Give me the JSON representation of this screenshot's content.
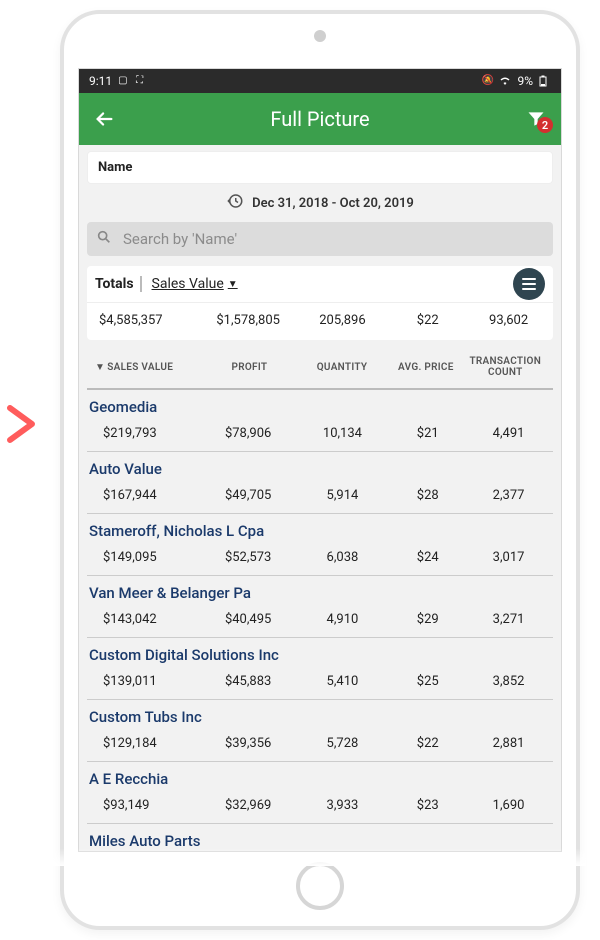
{
  "statusbar": {
    "time": "9:11",
    "battery": "9%"
  },
  "header": {
    "title": "Full Picture",
    "filter_badge": "2"
  },
  "filter_pill": {
    "label": "Name"
  },
  "date_range": {
    "text": "Dec 31, 2018 - Oct 20, 2019"
  },
  "search": {
    "placeholder": "Search by 'Name'"
  },
  "totals": {
    "label": "Totals",
    "sort_by": "Sales Value",
    "values": {
      "sales_value": "$4,585,357",
      "profit": "$1,578,805",
      "quantity": "205,896",
      "avg_price": "$22",
      "transaction_count": "93,602"
    }
  },
  "columns": {
    "sales_value": "SALES VALUE",
    "profit": "PROFIT",
    "quantity": "QUANTITY",
    "avg_price": "AVG. PRICE",
    "transaction_count": "TRANSACTION COUNT"
  },
  "rows": [
    {
      "name": "Geomedia",
      "sales_value": "$219,793",
      "profit": "$78,906",
      "quantity": "10,134",
      "avg_price": "$21",
      "transaction_count": "4,491"
    },
    {
      "name": "Auto Value",
      "sales_value": "$167,944",
      "profit": "$49,705",
      "quantity": "5,914",
      "avg_price": "$28",
      "transaction_count": "2,377"
    },
    {
      "name": "Stameroff, Nicholas L Cpa",
      "sales_value": "$149,095",
      "profit": "$52,573",
      "quantity": "6,038",
      "avg_price": "$24",
      "transaction_count": "3,017"
    },
    {
      "name": "Van Meer & Belanger Pa",
      "sales_value": "$143,042",
      "profit": "$40,495",
      "quantity": "4,910",
      "avg_price": "$29",
      "transaction_count": "3,271"
    },
    {
      "name": "Custom Digital Solutions Inc",
      "sales_value": "$139,011",
      "profit": "$45,883",
      "quantity": "5,410",
      "avg_price": "$25",
      "transaction_count": "3,852"
    },
    {
      "name": "Custom Tubs Inc",
      "sales_value": "$129,184",
      "profit": "$39,356",
      "quantity": "5,728",
      "avg_price": "$22",
      "transaction_count": "2,881"
    },
    {
      "name": "A E Recchia",
      "sales_value": "$93,149",
      "profit": "$32,969",
      "quantity": "3,933",
      "avg_price": "$23",
      "transaction_count": "1,690"
    },
    {
      "name": "Miles Auto Parts",
      "sales_value": "",
      "profit": "",
      "quantity": "",
      "avg_price": "",
      "transaction_count": ""
    }
  ]
}
